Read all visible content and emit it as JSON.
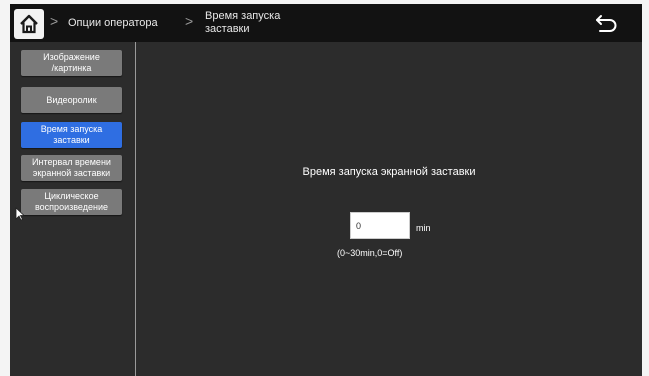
{
  "header": {
    "home_icon": "home-icon",
    "back_icon": "return-arrow-icon",
    "breadcrumb": {
      "item1": "Опции оператора",
      "item2_line1": "Время запуска",
      "item2_line2": "заставки"
    }
  },
  "sidebar": {
    "items": [
      {
        "line1": "Изображение",
        "line2": "/картинка"
      },
      {
        "line1": "Видеоролик",
        "line2": ""
      },
      {
        "line1": "Время запуска",
        "line2": "заставки"
      },
      {
        "line1": "Интервал времени",
        "line2": "экранной заставки"
      },
      {
        "line1": "Циклическое",
        "line2": "воспроизведение"
      }
    ],
    "active_index": 2
  },
  "main": {
    "title": "Время запуска экранной заставки",
    "value": "0",
    "unit": "min",
    "hint": "(0~30min,0=Off)"
  },
  "colors": {
    "accent": "#2f6ee2",
    "panel": "#2c2c2c",
    "topbar": "#121212",
    "button": "#7a7a7a"
  }
}
